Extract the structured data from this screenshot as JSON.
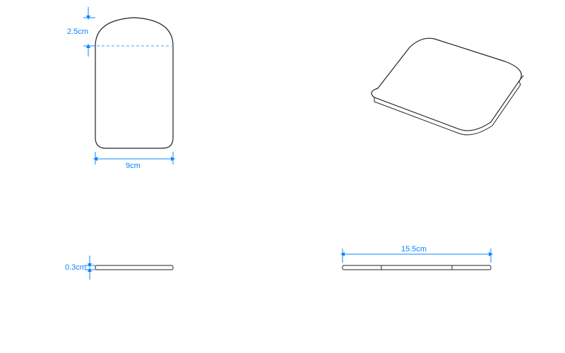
{
  "dimensions": {
    "top_radius": "2.5cm",
    "width": "9cm",
    "thickness": "0.3cm",
    "length": "15.5cm"
  },
  "views": {
    "top_left": "front-view",
    "top_right": "isometric-view",
    "bottom_left": "side-edge-view",
    "bottom_right": "length-edge-view"
  }
}
